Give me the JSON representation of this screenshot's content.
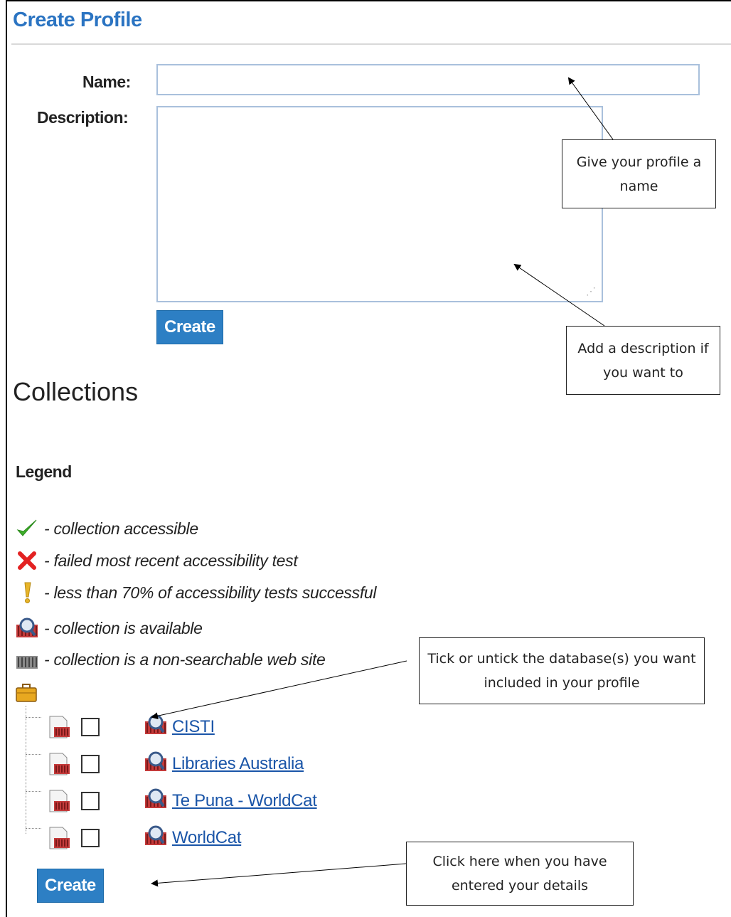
{
  "page": {
    "title": "Create Profile"
  },
  "form": {
    "name_label": "Name:",
    "name_value": "",
    "description_label": "Description:",
    "description_value": "",
    "create_label": "Create"
  },
  "collections": {
    "heading": "Collections",
    "legend_heading": "Legend",
    "legend": [
      {
        "icon": "checkmark-icon",
        "text": "- collection accessible",
        "color": "#3fae2a"
      },
      {
        "icon": "red-x-icon",
        "text": "- failed most recent accessibility test",
        "color": "#e32222"
      },
      {
        "icon": "exclamation-icon",
        "text": "- less than 70% of accessibility tests successful",
        "color": "#e8b52a"
      },
      {
        "icon": "available-collection-icon",
        "text": "- collection is available"
      },
      {
        "icon": "non-searchable-site-icon",
        "text": "- collection is a non-searchable web site"
      }
    ],
    "group_icon": "briefcase-icon",
    "items": [
      {
        "name": "CISTI",
        "checked": false
      },
      {
        "name": "Libraries Australia",
        "checked": false
      },
      {
        "name": "Te Puna - WorldCat",
        "checked": false
      },
      {
        "name": "WorldCat",
        "checked": false
      }
    ],
    "create_label": "Create"
  },
  "callouts": {
    "name_hint": "Give your profile a name",
    "description_hint": "Add a description if you want to",
    "tick_hint": "Tick or untick the database(s) you want included in your profile",
    "create_hint": "Click here when you have entered your details"
  },
  "colors": {
    "title": "#2b74c2",
    "button": "#2d7fc4",
    "link": "#1a55a8",
    "input_border": "#a9c0dc"
  }
}
